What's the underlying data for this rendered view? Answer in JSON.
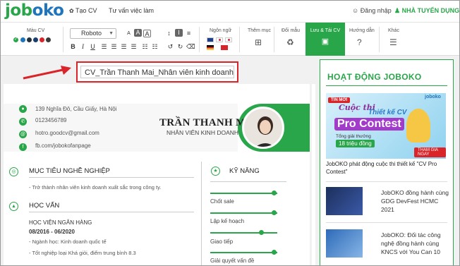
{
  "topnav": {
    "logo_job": "job",
    "logo_oko": "oko",
    "create_cv": "Tạo CV",
    "career_advice": "Tư vấn việc làm",
    "login": "Đăng nhập",
    "employer": "NHÀ TUYỂN DỤNG"
  },
  "toolbar": {
    "color_label": "Màu CV",
    "font_name": "Roboto",
    "language_label": "Ngôn ngữ",
    "add_section_label": "Thêm mục",
    "change_template_label": "Đổi mẫu",
    "save_label": "Lưu & Tải CV",
    "guide_label": "Hướng dẫn",
    "other_label": "Khác",
    "colors": [
      "#2aa64a",
      "#1e75bb",
      "#22323f",
      "#1a3e6e",
      "#d9242a",
      "#3a3a3a"
    ]
  },
  "cv_title": "CV_Trần Thanh Mai_Nhân viên kinh doanh",
  "cv": {
    "address": "139 Nghĩa Đô, Cầu Giấy, Hà Nội",
    "phone": "0123456789",
    "email": "hotro.goodcv@gmail.com",
    "facebook": "fb.com/jobokofanpage",
    "name": "TRẦN THANH MAI",
    "position": "NHÂN VIÊN KINH DOANH",
    "objective_title": "MỤC TIÊU NGHỀ NGHIỆP",
    "objective_text": "- Trở thành nhân viên kinh doanh xuất sắc trong công ty.",
    "education_title": "HỌC VẤN",
    "school": "HỌC VIỆN NGÂN HÀNG",
    "period": "08/2016 - 06/2020",
    "major": "- Ngành học: Kinh doanh quốc tế",
    "grade": "- Tốt nghiệp loại Khá giỏi, điểm trung bình 8.3",
    "skills_title": "KỸ NĂNG",
    "skills": [
      {
        "label": "Chốt sale",
        "level": 0.95
      },
      {
        "label": "Lập kế hoạch",
        "level": 0.95
      },
      {
        "label": "Giao tiếp",
        "level": 0.76
      },
      {
        "label": "Giải quyết vấn đề",
        "level": 0.95
      }
    ]
  },
  "panel": {
    "title": "HOẠT ĐỘNG JOBOKO",
    "banner": {
      "tag": "TIN MỚI",
      "l1": "Cuộc thi",
      "l2": "Thiết kế CV",
      "l3": "Pro Contest",
      "l4": "Tổng giải thưởng",
      "l5": "18 triệu đồng",
      "btn": "THAM GIA NGAY",
      "logo": "joboko"
    },
    "caption": "JobOKO phát động cuộc thi thiết kế \"CV Pro Contest\"",
    "news": [
      {
        "text": "JobOKO đồng hành cùng GDG DevFest HCMC 2021"
      },
      {
        "text": "JobOKO: Đối tác công nghệ đồng hành cùng KNCS với You Can 10"
      }
    ]
  }
}
